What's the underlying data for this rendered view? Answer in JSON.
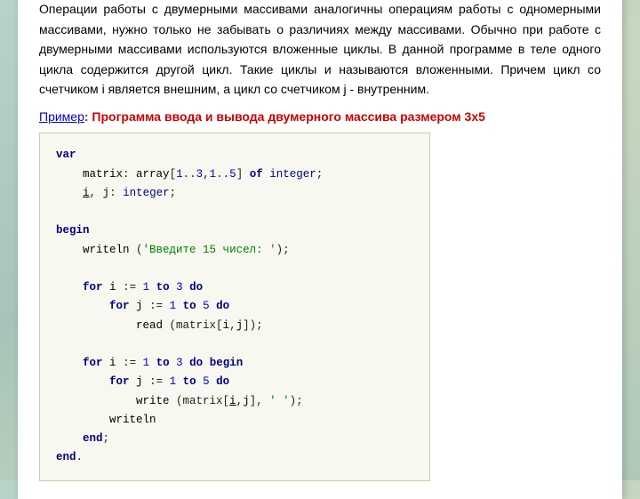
{
  "card": {
    "main_text": "Операции работы с двумерными массивами аналогичны операциям работы с одномерными массивами, нужно только не забывать о различиях между массивами. Обычно при работе с двумерными массивами используются вложенные циклы. В данной программе в теле одного цикла содержится другой цикл. Такие циклы и называются вложенными. Причем цикл со счетчиком i является внешним, а цикл со счетчиком j - внутренним.",
    "example_label": "Пример",
    "example_desc": ": Программа ввода и вывода двумерного массива размером 3х5"
  }
}
